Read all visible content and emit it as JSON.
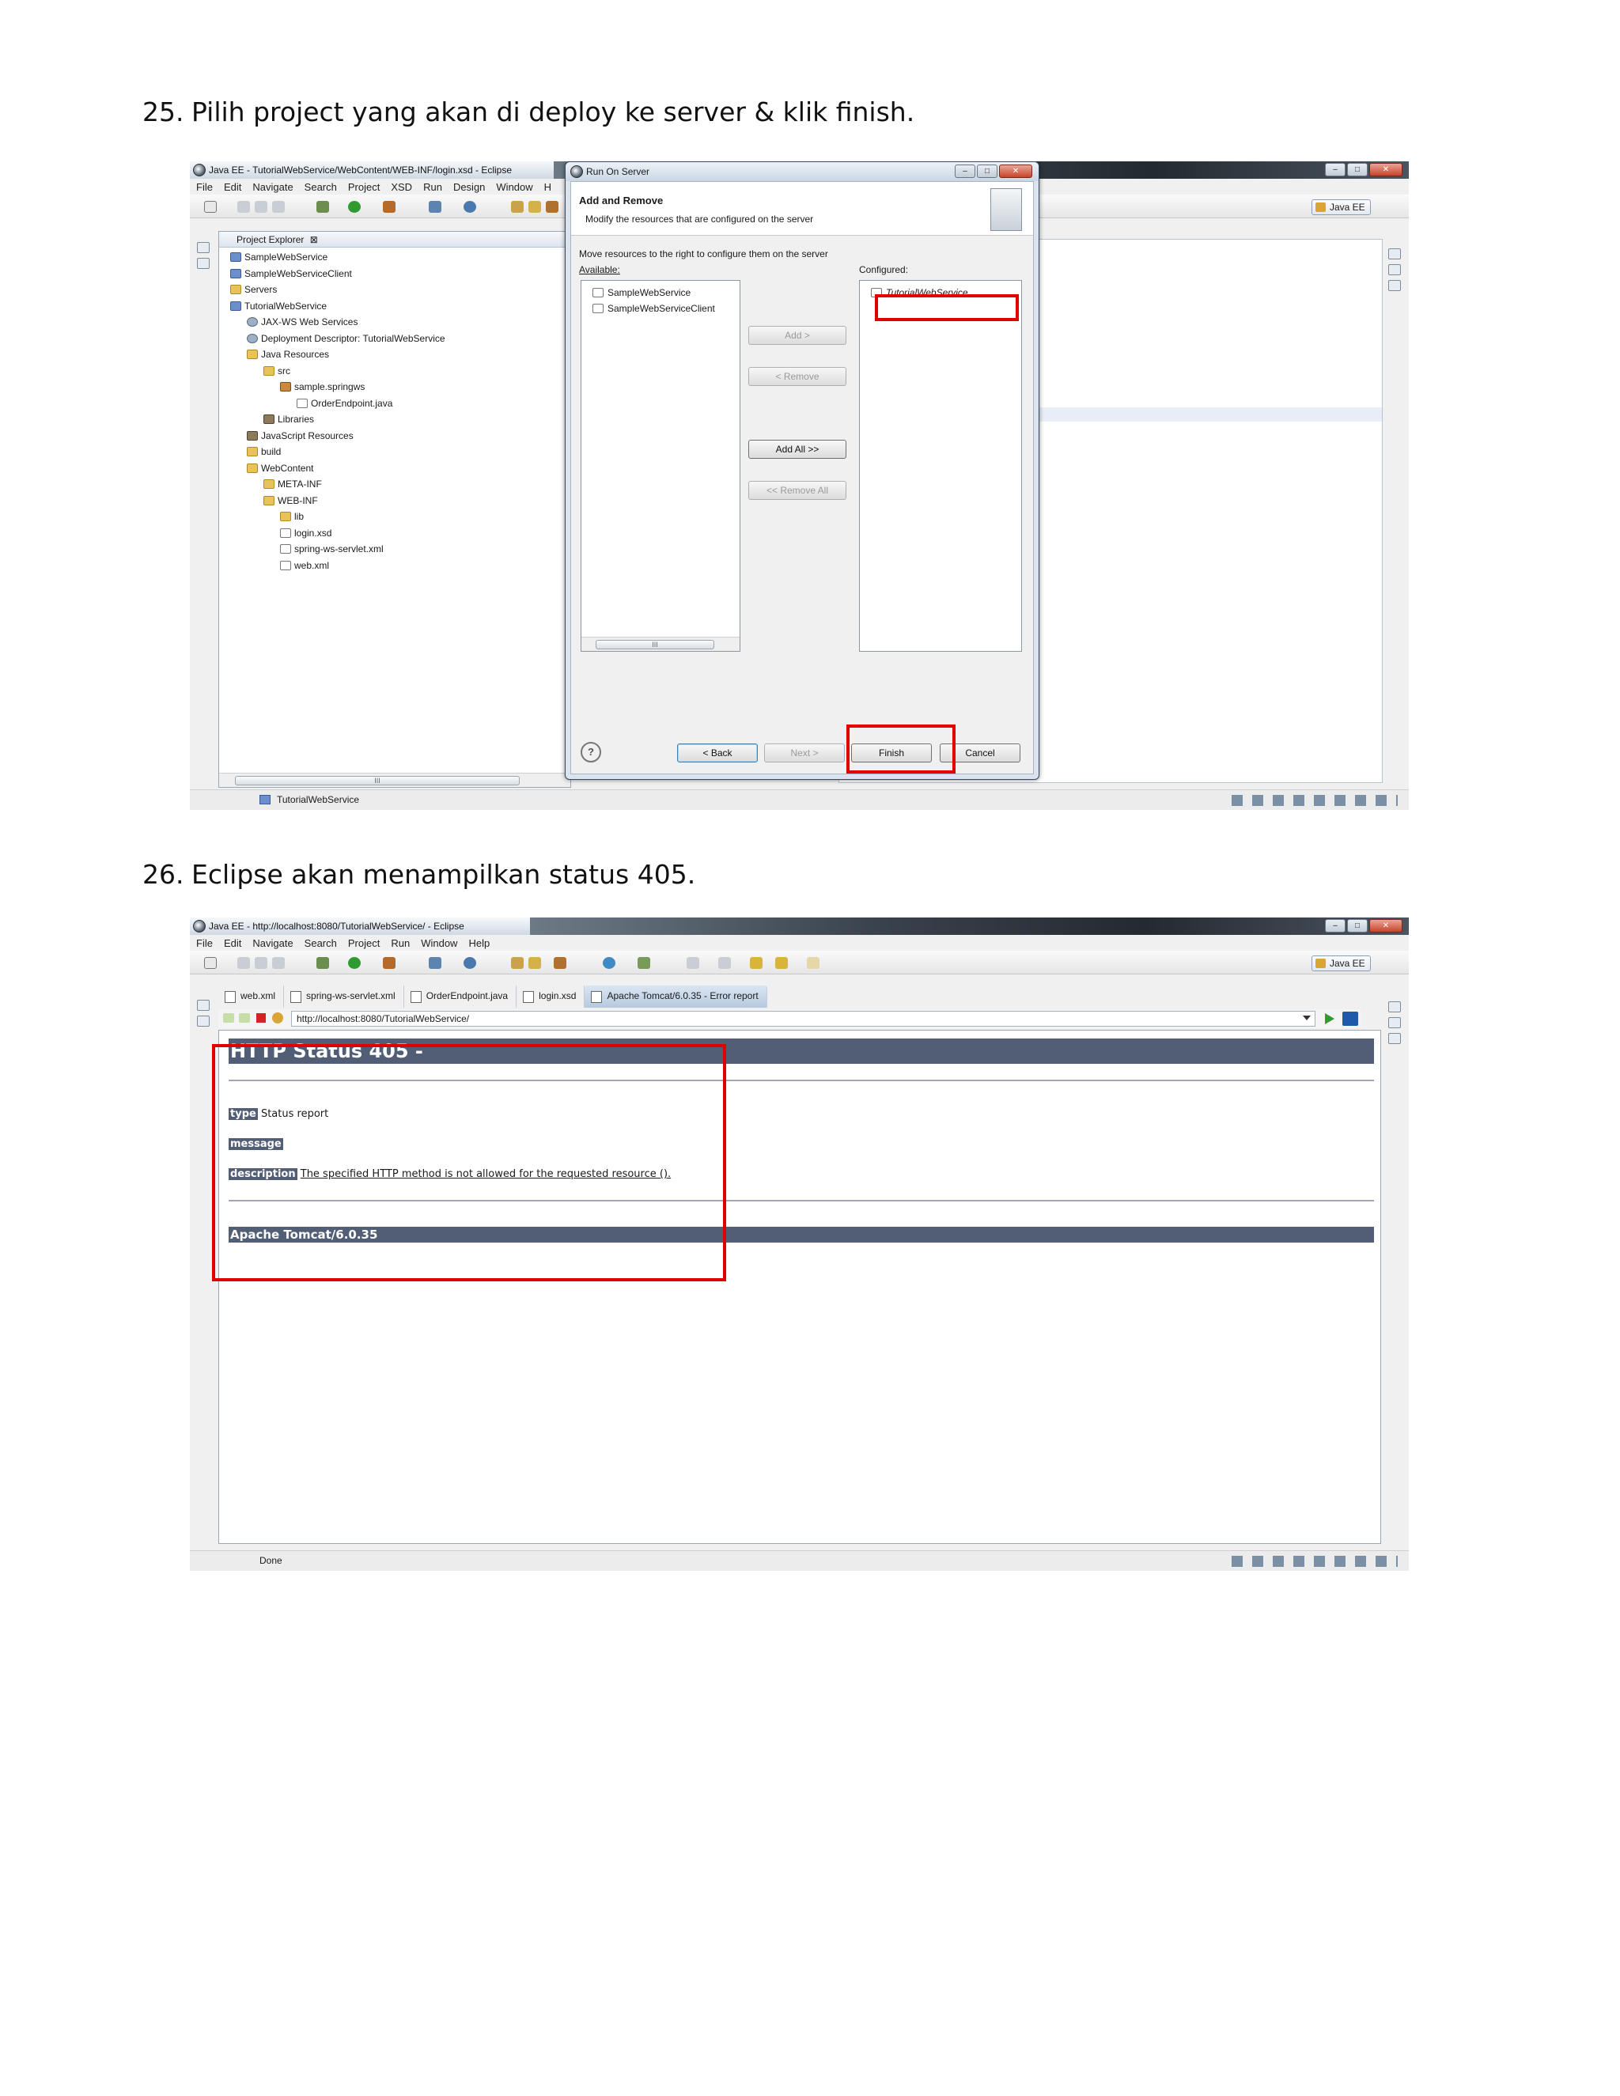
{
  "step25": {
    "number": "25.",
    "text": "Pilih project yang akan di deploy ke server & klik finish."
  },
  "step26": {
    "number": "26.",
    "text": "Eclipse akan menampilkan status 405."
  },
  "shot1": {
    "window_title": "Java EE - TutorialWebService/WebContent/WEB-INF/login.xsd - Eclipse",
    "menu": [
      "File",
      "Edit",
      "Navigate",
      "Search",
      "Project",
      "XSD",
      "Run",
      "Design",
      "Window",
      "H"
    ],
    "perspective": "Java EE",
    "explorer_title": "Project Explorer",
    "explorer_close": "⊠",
    "tree": [
      {
        "label": "SampleWebService",
        "indent": 0,
        "icon": "proj"
      },
      {
        "label": "SampleWebServiceClient",
        "indent": 0,
        "icon": "proj"
      },
      {
        "label": "Servers",
        "indent": 0,
        "icon": "folder"
      },
      {
        "label": "TutorialWebService",
        "indent": 0,
        "icon": "proj"
      },
      {
        "label": "JAX-WS Web Services",
        "indent": 1,
        "icon": "gear"
      },
      {
        "label": "Deployment Descriptor: TutorialWebService",
        "indent": 1,
        "icon": "gear"
      },
      {
        "label": "Java Resources",
        "indent": 1,
        "icon": "folder"
      },
      {
        "label": "src",
        "indent": 2,
        "icon": "folder"
      },
      {
        "label": "sample.springws",
        "indent": 3,
        "icon": "pkg"
      },
      {
        "label": "OrderEndpoint.java",
        "indent": 4,
        "icon": "file"
      },
      {
        "label": "Libraries",
        "indent": 2,
        "icon": "lib"
      },
      {
        "label": "JavaScript Resources",
        "indent": 1,
        "icon": "lib"
      },
      {
        "label": "build",
        "indent": 1,
        "icon": "folder"
      },
      {
        "label": "WebContent",
        "indent": 1,
        "icon": "folder"
      },
      {
        "label": "META-INF",
        "indent": 2,
        "icon": "folder"
      },
      {
        "label": "WEB-INF",
        "indent": 2,
        "icon": "folder"
      },
      {
        "label": "lib",
        "indent": 3,
        "icon": "folder"
      },
      {
        "label": "login.xsd",
        "indent": 3,
        "icon": "file"
      },
      {
        "label": "spring-ws-servlet.xml",
        "indent": 3,
        "icon": "file"
      },
      {
        "label": "web.xml",
        "indent": 3,
        "icon": "file"
      }
    ],
    "scroll_grip": "III",
    "status_project": "TutorialWebService",
    "dialog": {
      "title": "Run On Server",
      "header_title": "Add and Remove",
      "header_desc": "Modify the resources that are configured on the server",
      "instruction": "Move resources to the right to configure them on the server",
      "available_label": "Available:",
      "configured_label": "Configured:",
      "available": [
        "SampleWebService",
        "SampleWebServiceClient"
      ],
      "configured": [
        "TutorialWebService"
      ],
      "buttons": {
        "add": "Add >",
        "remove": "< Remove",
        "add_all": "Add All >>",
        "remove_all": "<< Remove All",
        "back": "< Back",
        "next": "Next >",
        "finish": "Finish",
        "cancel": "Cancel",
        "help": "?"
      }
    }
  },
  "shot2": {
    "window_title": "Java EE - http://localhost:8080/TutorialWebService/ - Eclipse",
    "menu": [
      "File",
      "Edit",
      "Navigate",
      "Search",
      "Project",
      "Run",
      "Window",
      "Help"
    ],
    "perspective": "Java EE",
    "tabs": [
      "web.xml",
      "spring-ws-servlet.xml",
      "OrderEndpoint.java",
      "login.xsd",
      "Apache Tomcat/6.0.35 - Error report"
    ],
    "url": "http://localhost:8080/TutorialWebService/",
    "page": {
      "heading": "HTTP Status 405 -",
      "type_label": "type",
      "type_value": "Status report",
      "message_label": "message",
      "description_label": "description",
      "description_value": "The specified HTTP method is not allowed for the requested resource ().",
      "footer": "Apache Tomcat/6.0.35"
    },
    "status": "Done"
  },
  "colors": {
    "tomcat_header": "#525d76",
    "highlight_red": "#e00000"
  }
}
